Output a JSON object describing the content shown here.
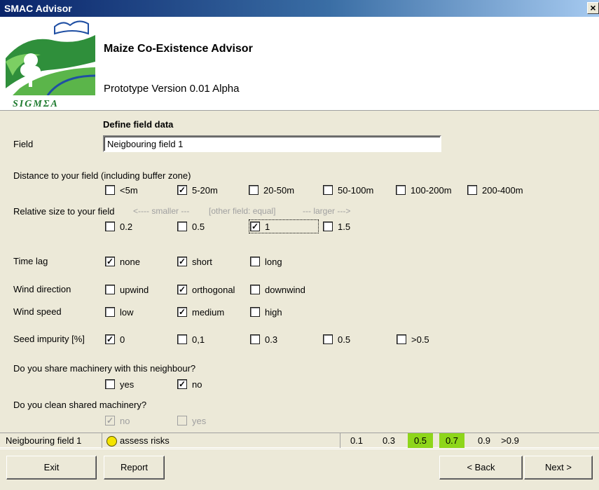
{
  "window": {
    "title": "SMAC Advisor",
    "close_glyph": "×"
  },
  "header": {
    "logo_text": "SIGMΣA",
    "app_title": "Maize Co-Existence Advisor",
    "version": "Prototype Version 0.01 Alpha"
  },
  "form": {
    "section_title": "Define field data",
    "field_label": "Field",
    "field_value": "Neigbouring field 1",
    "distance": {
      "label": "Distance to your field (including buffer zone)",
      "options": [
        {
          "label": "<5m",
          "checked": false
        },
        {
          "label": "5-20m",
          "checked": true
        },
        {
          "label": "20-50m",
          "checked": false
        },
        {
          "label": "50-100m",
          "checked": false
        },
        {
          "label": "100-200m",
          "checked": false
        },
        {
          "label": "200-400m",
          "checked": false
        }
      ]
    },
    "relative_size": {
      "label": "Relative size to your field",
      "hint_smaller": "<---- smaller ---",
      "hint_equal": "[other field: equal]",
      "hint_larger": "--- larger --->",
      "options": [
        {
          "label": "0.2",
          "checked": false
        },
        {
          "label": "0.5",
          "checked": false
        },
        {
          "label": "1",
          "checked": true
        },
        {
          "label": "1.5",
          "checked": false
        }
      ]
    },
    "time_lag": {
      "label": "Time lag",
      "options": [
        {
          "label": "none",
          "checked": true
        },
        {
          "label": "short",
          "checked": true
        },
        {
          "label": "long",
          "checked": false
        }
      ]
    },
    "wind_direction": {
      "label": "Wind direction",
      "options": [
        {
          "label": "upwind",
          "checked": false
        },
        {
          "label": "orthogonal",
          "checked": true
        },
        {
          "label": "downwind",
          "checked": false
        }
      ]
    },
    "wind_speed": {
      "label": "Wind speed",
      "options": [
        {
          "label": "low",
          "checked": false
        },
        {
          "label": "medium",
          "checked": true
        },
        {
          "label": "high",
          "checked": false
        }
      ]
    },
    "seed_impurity": {
      "label": "Seed impurity [%]",
      "options": [
        {
          "label": "0",
          "checked": true
        },
        {
          "label": "0,1",
          "checked": false
        },
        {
          "label": "0.3",
          "checked": false
        },
        {
          "label": "0.5",
          "checked": false
        },
        {
          "label": ">0.5",
          "checked": false
        }
      ]
    },
    "share_machinery": {
      "label": "Do you share machinery with this neighbour?",
      "options": [
        {
          "label": "yes",
          "checked": false
        },
        {
          "label": "no",
          "checked": true
        }
      ]
    },
    "clean_machinery": {
      "label": "Do you clean shared machinery?",
      "options": [
        {
          "label": "no",
          "checked": true
        },
        {
          "label": "yes",
          "checked": false
        }
      ]
    }
  },
  "status": {
    "field_name": "Neigbouring field 1",
    "assess_label": "assess risks",
    "indicator_color": "#f4e400",
    "highlight_color": "#8ed61a",
    "scale": [
      "0.1",
      "0.3",
      "0.5",
      "0.7",
      "0.9",
      ">0.9"
    ]
  },
  "buttons": {
    "exit": "Exit",
    "report": "Report",
    "back": "< Back",
    "next": "Next >"
  }
}
